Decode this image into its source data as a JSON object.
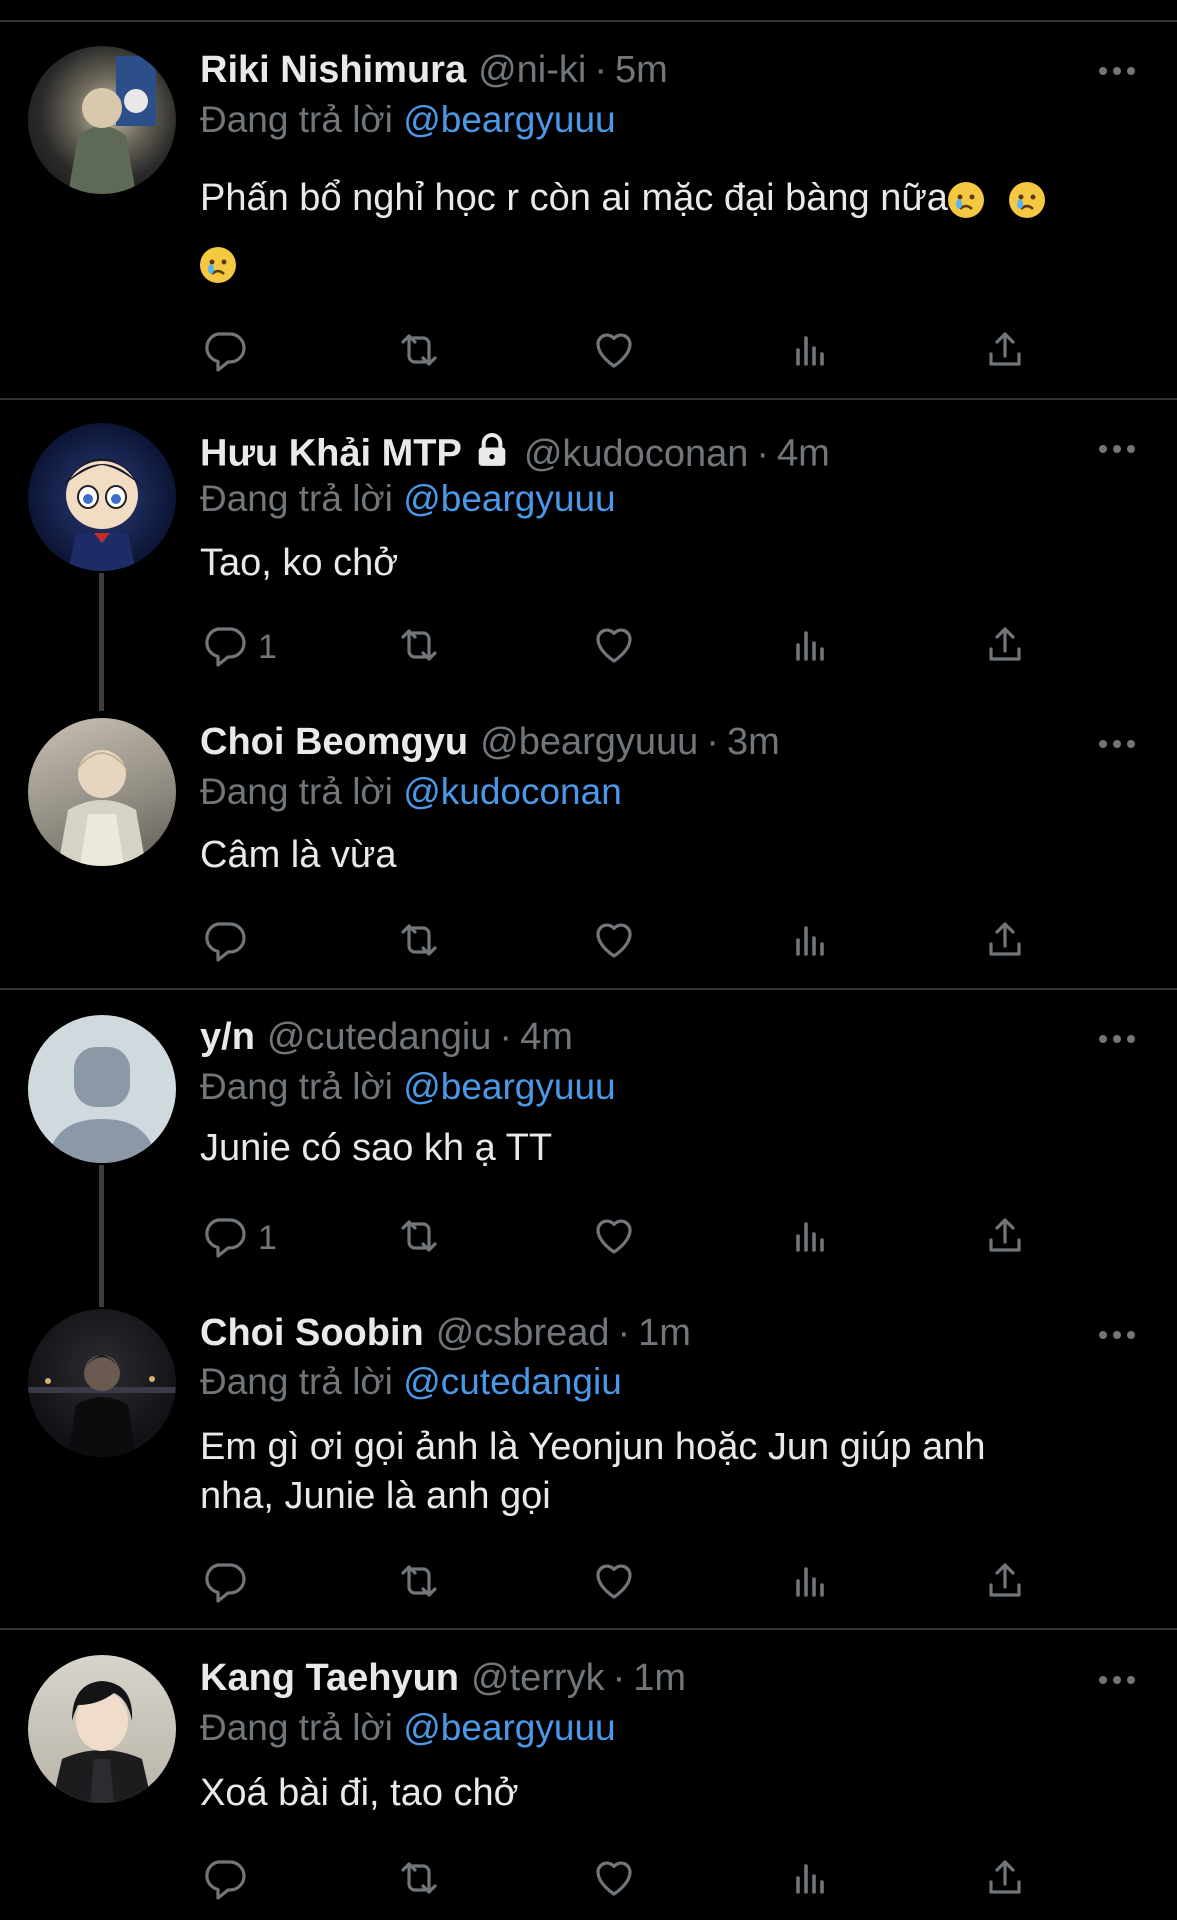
{
  "reply_prefix": "Đang trả lời",
  "tweets": [
    {
      "name": "Riki Nishimura",
      "handle": "@ni-ki",
      "time": "5m",
      "reply_to": "@beargyuuu",
      "text_line1": "Phấn bổ nghỉ học r còn ai mặc đại bàng nữa",
      "emoji_names": [
        "crying-face-emoji",
        "crying-face-emoji",
        "crying-face-emoji"
      ],
      "reply_count": ""
    },
    {
      "name": "Hưu Khải MTP",
      "handle": "@kudoconan",
      "time": "4m",
      "reply_to": "@beargyuuu",
      "text": "Tao, ko chở",
      "reply_count": "1",
      "locked": true
    },
    {
      "name": "Choi Beomgyu",
      "handle": "@beargyuuu",
      "time": "3m",
      "reply_to": "@kudoconan",
      "text": "Câm là vừa",
      "reply_count": ""
    },
    {
      "name": "y/n",
      "handle": "@cutedangiu",
      "time": "4m",
      "reply_to": "@beargyuuu",
      "text": "Junie có sao kh ạ TT",
      "reply_count": "1"
    },
    {
      "name": "Choi Soobin",
      "handle": "@csbread",
      "time": "1m",
      "reply_to": "@cutedangiu",
      "text_line1": "Em gì ơi gọi ảnh là Yeonjun hoặc Jun giúp anh",
      "text_line2": "nha, Junie là anh gọi",
      "reply_count": ""
    },
    {
      "name": "Kang Taehyun",
      "handle": "@terryk",
      "time": "1m",
      "reply_to": "@beargyuuu",
      "text": "Xoá bài đi, tao chở",
      "reply_count": ""
    }
  ],
  "icons": {
    "reply": "reply-icon",
    "retweet": "retweet-icon",
    "like": "heart-icon",
    "views": "views-icon",
    "share": "share-icon",
    "more": "more-options-icon",
    "lock": "lock-icon"
  },
  "colors": {
    "background": "#000000",
    "text": "#e7e9ea",
    "muted": "#71767b",
    "mention": "#4a99e9",
    "divider": "#2f3336"
  }
}
